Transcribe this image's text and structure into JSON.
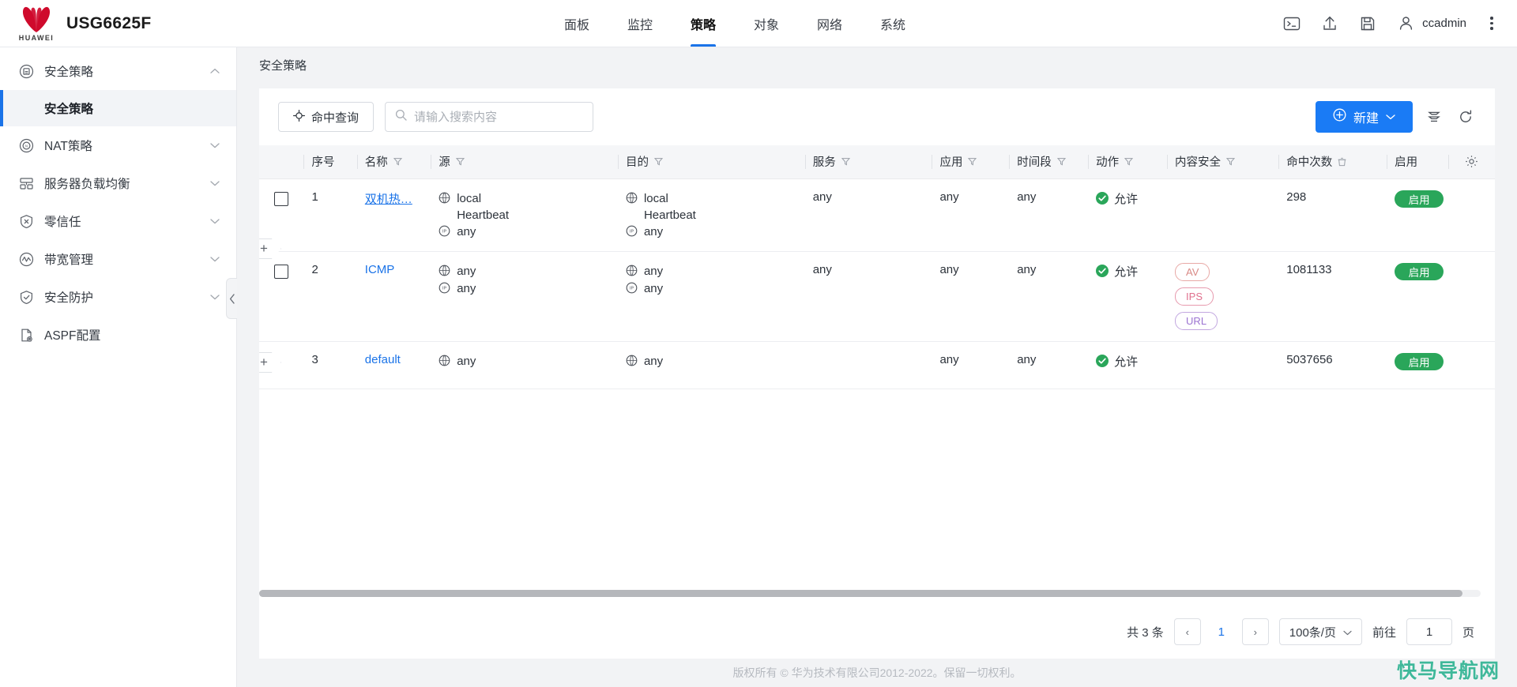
{
  "header": {
    "brand_name": "HUAWEI",
    "product": "USG6625F",
    "nav": [
      {
        "label": "面板",
        "active": false
      },
      {
        "label": "监控",
        "active": false
      },
      {
        "label": "策略",
        "active": true
      },
      {
        "label": "对象",
        "active": false
      },
      {
        "label": "网络",
        "active": false
      },
      {
        "label": "系统",
        "active": false
      }
    ],
    "icons": [
      "terminal-icon",
      "upload-icon",
      "save-icon"
    ],
    "user": "ccadmin"
  },
  "sidebar": {
    "items": [
      {
        "label": "安全策略",
        "icon": "security-policy-icon",
        "expanded": true
      },
      {
        "label": "NAT策略",
        "icon": "nat-policy-icon",
        "expanded": false
      },
      {
        "label": "服务器负载均衡",
        "icon": "server-lb-icon",
        "expanded": false
      },
      {
        "label": "零信任",
        "icon": "zero-trust-icon",
        "expanded": false
      },
      {
        "label": "带宽管理",
        "icon": "bandwidth-icon",
        "expanded": false
      },
      {
        "label": "安全防护",
        "icon": "shield-icon",
        "expanded": false
      },
      {
        "label": "ASPF配置",
        "icon": "aspf-icon",
        "expanded": null
      }
    ],
    "sub_item": "安全策略"
  },
  "breadcrumb": "安全策略",
  "toolbar": {
    "hit_query_label": "命中查询",
    "search_placeholder": "请输入搜索内容",
    "search_value": "",
    "new_label": "新建",
    "layout_icon": "column-layout-icon",
    "refresh_icon": "refresh-icon"
  },
  "table": {
    "columns": [
      {
        "key": "seq",
        "label": "序号",
        "filter": false
      },
      {
        "key": "name",
        "label": "名称",
        "filter": true
      },
      {
        "key": "src",
        "label": "源",
        "filter": true
      },
      {
        "key": "dst",
        "label": "目的",
        "filter": true
      },
      {
        "key": "service",
        "label": "服务",
        "filter": true
      },
      {
        "key": "app",
        "label": "应用",
        "filter": true
      },
      {
        "key": "period",
        "label": "时间段",
        "filter": true
      },
      {
        "key": "action",
        "label": "动作",
        "filter": true
      },
      {
        "key": "content",
        "label": "内容安全",
        "filter": true
      },
      {
        "key": "hits",
        "label": "命中次数",
        "filter": false
      },
      {
        "key": "enabled",
        "label": "启用",
        "filter": false
      }
    ],
    "settings_icon": "gear-icon",
    "rows": [
      {
        "checkbox": true,
        "seq": "1",
        "name": "双机热…",
        "name_underline": true,
        "src": [
          {
            "icon": "zone-icon",
            "text": "local"
          },
          {
            "icon": "",
            "text": "Heartbeat"
          },
          {
            "icon": "ip-icon",
            "text": "any"
          }
        ],
        "dst": [
          {
            "icon": "zone-icon",
            "text": "local"
          },
          {
            "icon": "",
            "text": "Heartbeat"
          },
          {
            "icon": "ip-icon",
            "text": "any"
          }
        ],
        "service": "any",
        "app": "any",
        "period": "any",
        "action": "允许",
        "content": [],
        "hits": "298",
        "enabled": "启用"
      },
      {
        "checkbox": true,
        "seq": "2",
        "name": "ICMP",
        "name_underline": false,
        "src": [
          {
            "icon": "zone-icon",
            "text": "any"
          },
          {
            "icon": "ip-icon",
            "text": "any"
          }
        ],
        "dst": [
          {
            "icon": "zone-icon",
            "text": "any"
          },
          {
            "icon": "ip-icon",
            "text": "any"
          }
        ],
        "service": "any",
        "app": "any",
        "period": "any",
        "action": "允许",
        "content": [
          "AV",
          "IPS",
          "URL"
        ],
        "hits": "1081133",
        "enabled": "启用"
      },
      {
        "checkbox": false,
        "seq": "3",
        "name": "default",
        "name_underline": false,
        "src": [
          {
            "icon": "zone-icon",
            "text": "any"
          }
        ],
        "dst": [
          {
            "icon": "zone-icon",
            "text": "any"
          }
        ],
        "service": "",
        "app": "any",
        "period": "any",
        "action": "允许",
        "content": [],
        "hits": "5037656",
        "enabled": "启用"
      }
    ],
    "insert_label": "+"
  },
  "pagination": {
    "total_text": "共 3 条",
    "prev": "‹",
    "current_page": "1",
    "next": "›",
    "page_size": "100条/页",
    "goto_label": "前往",
    "goto_value": "1",
    "page_unit": "页"
  },
  "footer": {
    "copyright": "版权所有 © 华为技术有限公司2012-2022。保留一切权利。",
    "watermark": "快马导航网"
  },
  "colors": {
    "accent_blue": "#1a7bf5",
    "link_blue": "#1a73e8",
    "success_green": "#2aa65a",
    "huawei_red": "#cf0a2c",
    "tag_av": "#d98a86",
    "tag_ips": "#e0708e",
    "tag_url": "#9b72d1",
    "watermark_teal": "#3fb89a"
  }
}
